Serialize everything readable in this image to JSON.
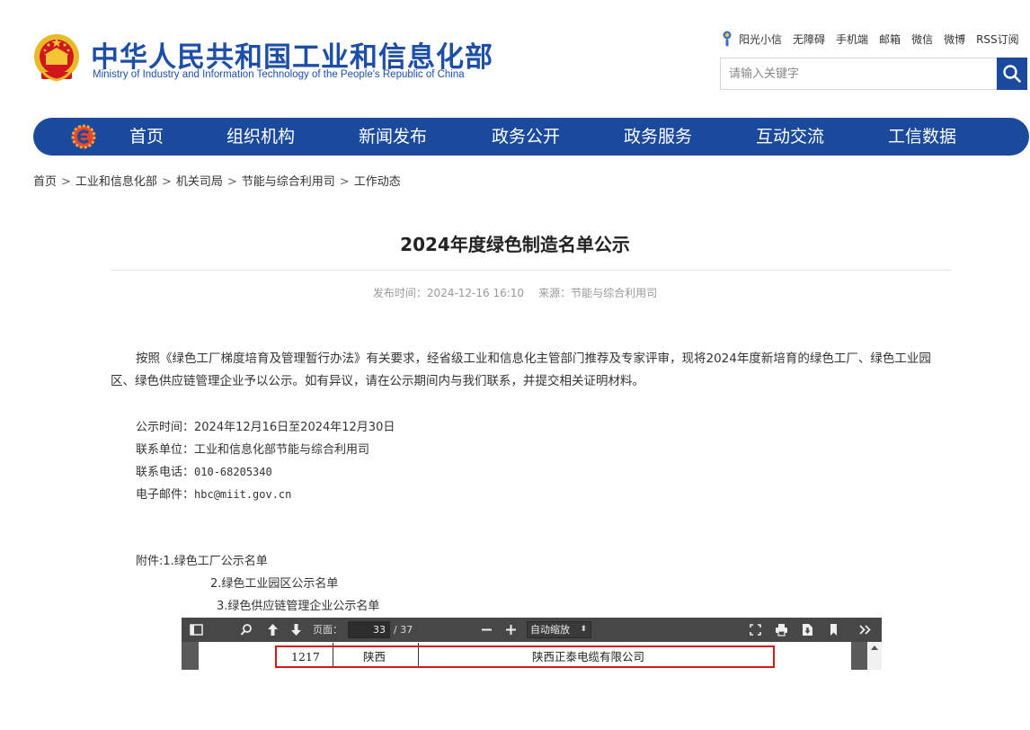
{
  "header": {
    "site_title": "中华人民共和国工业和信息化部",
    "site_subtitle": "Ministry of Industry and Information Technology of the People's Republic of China",
    "emblem_icon": "national-emblem-icon",
    "top_links": [
      "阳光小信",
      "无障碍",
      "手机端",
      "邮箱",
      "微信",
      "微博",
      "RSS订阅"
    ],
    "search_placeholder": "请输入关键字",
    "search_icon": "search-icon"
  },
  "nav": {
    "logo_icon": "miit-logo-icon",
    "items": [
      "首页",
      "组织机构",
      "新闻发布",
      "政务公开",
      "政务服务",
      "互动交流",
      "工信数据"
    ]
  },
  "breadcrumb": [
    "首页",
    "工业和信息化部",
    "机关司局",
    "节能与综合利用司",
    "工作动态"
  ],
  "breadcrumb_separator": ">",
  "article": {
    "title": "2024年度绿色制造名单公示",
    "publish_time": "发布时间：2024-12-16 16:10",
    "source": "来源：节能与综合利用司",
    "paragraph": "按照《绿色工厂梯度培育及管理暂行办法》有关要求，经省级工业和信息化主管部门推荐及专家评审，现将2024年度新培育的绿色工厂、绿色工业园区、绿色供应链管理企业予以公示。如有异议，请在公示期间内与我们联系，并提交相关证明材料。",
    "info": {
      "period_label": "公示时间：",
      "period_value": "2024年12月16日至2024年12月30日",
      "unit_label": "联系单位：",
      "unit_value": "工业和信息化部节能与综合利用司",
      "phone_label": "联系电话：",
      "phone_value": "010-68205340",
      "email_label": "电子邮件：",
      "email_value": "hbc@miit.gov.cn"
    },
    "attachments_label": "附件:",
    "attachments": [
      "1.绿色工厂公示名单",
      "2.绿色工业园区公示名单",
      "3.绿色供应链管理企业公示名单"
    ]
  },
  "pdf_viewer": {
    "page_label": "页面：",
    "current_page": "33",
    "total_pages": "/ 37",
    "zoom_label": "自动缩放",
    "zoom_arrows": "⬍",
    "icons": [
      "sidebar-toggle-icon",
      "find-icon",
      "previous-page-icon",
      "next-page-icon",
      "zoom-out-icon",
      "zoom-in-icon",
      "presentation-mode-icon",
      "print-icon",
      "download-icon",
      "bookmark-icon",
      "tools-icon"
    ],
    "row": {
      "number": "1217",
      "province": "陕西",
      "company": "陕西正泰电缆有限公司"
    },
    "highlight_color": "#d31b1b"
  },
  "colors": {
    "brand_blue": "#1b4a9c",
    "title_blue": "#1d4fa8",
    "toolbar_gray": "#474747"
  }
}
